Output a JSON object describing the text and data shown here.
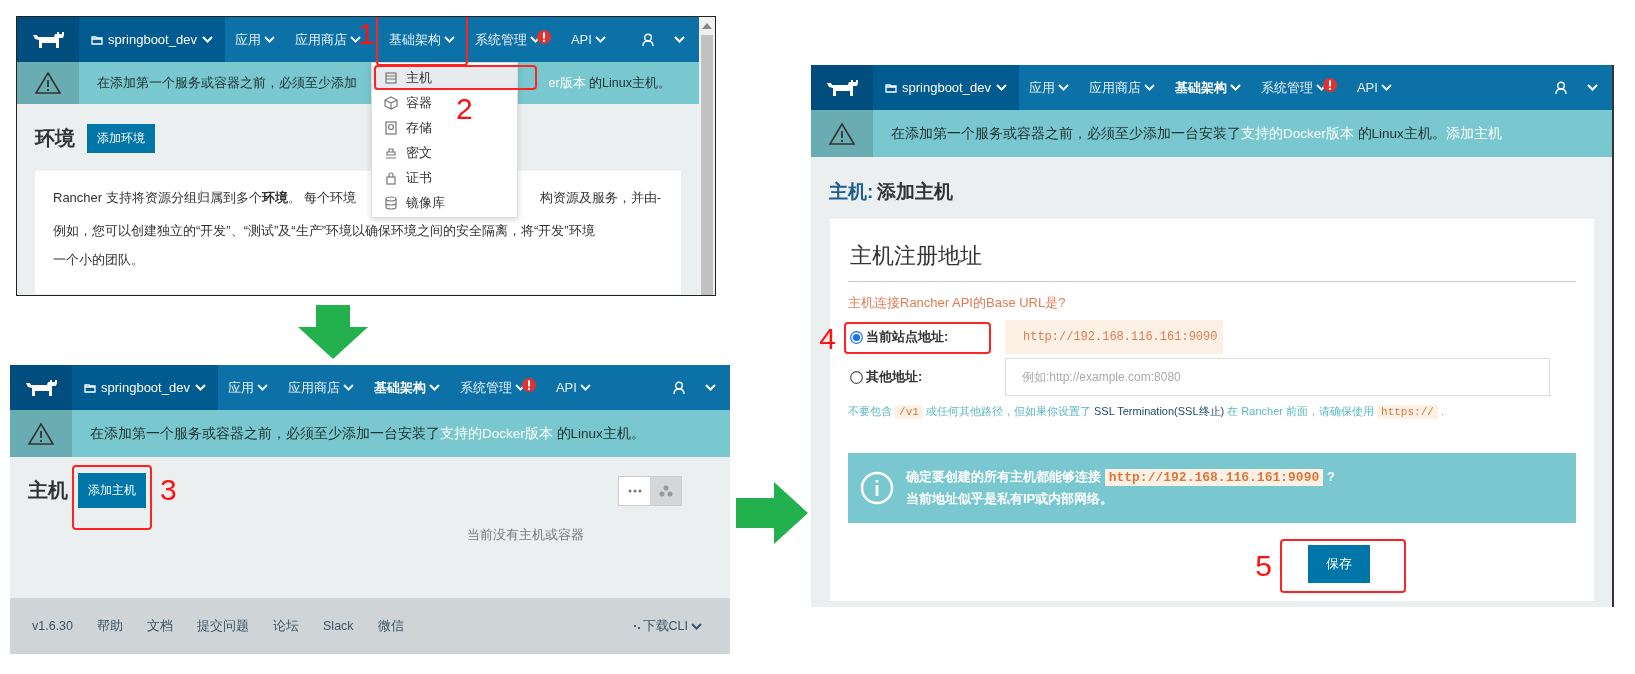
{
  "environments_screen": {
    "nav": {
      "environment": "springboot_dev",
      "items": [
        {
          "label": "应用",
          "selected": false,
          "alert": false
        },
        {
          "label": "应用商店",
          "selected": false,
          "alert": false
        },
        {
          "label": "基础架构",
          "selected": false,
          "alert": false,
          "annotation": "1",
          "menu": [
            {
              "label": "主机",
              "selected": true,
              "annotation": "2"
            },
            {
              "label": "容器",
              "selected": false
            },
            {
              "label": "存储",
              "selected": false
            },
            {
              "label": "密文",
              "selected": false
            },
            {
              "label": "证书",
              "selected": false
            },
            {
              "label": "镜像库",
              "selected": false
            }
          ]
        },
        {
          "label": "系统管理",
          "selected": false,
          "alert": true
        },
        {
          "label": "API",
          "selected": false,
          "alert": false
        }
      ]
    },
    "banner": {
      "text": "在添加第一个服务或容器之前，必须至少添加",
      "link_tail": "er版本",
      "text_tail": " 的Linux主机。"
    },
    "title": "环境",
    "add_button": "添加环境",
    "description_lines": [
      [
        "Rancher 支持将资源分组归属到多个**环境**。 每个环境",
        "构资源及服务，并由-"
      ],
      [
        "例如，您可以创建独立的“开发”、“测试”及“生产”环境以确保环境之间的安全隔离，将“开发”环境"
      ],
      [
        "一个小的团队。"
      ]
    ]
  },
  "hosts_screen": {
    "nav": {
      "environment": "springboot_dev",
      "items": [
        {
          "label": "应用",
          "selected": false,
          "alert": false
        },
        {
          "label": "应用商店",
          "selected": false,
          "alert": false
        },
        {
          "label": "基础架构",
          "selected": true,
          "alert": false
        },
        {
          "label": "系统管理",
          "selected": false,
          "alert": true
        },
        {
          "label": "API",
          "selected": false,
          "alert": false
        }
      ]
    },
    "banner": {
      "text": "在添加第一个服务或容器之前，必须至少添加一台安装了",
      "link": "支持的Docker版本",
      "text_after": " 的Linux主机。"
    },
    "title": "主机",
    "add_button": {
      "label": "添加主机",
      "annotation": "3"
    },
    "view_toggle": [
      {
        "selected": false
      },
      {
        "selected": true
      }
    ],
    "empty_message": "当前没有主机或容器",
    "footer": {
      "version": "v1.6.30",
      "links": [
        "帮助",
        "文档",
        "提交问题",
        "论坛",
        "Slack",
        "微信"
      ],
      "download": "下载CLI"
    }
  },
  "add_host_screen": {
    "nav": {
      "environment": "springboot_dev",
      "items": [
        {
          "label": "应用",
          "selected": false,
          "alert": false
        },
        {
          "label": "应用商店",
          "selected": false,
          "alert": false
        },
        {
          "label": "基础架构",
          "selected": true,
          "alert": false
        },
        {
          "label": "系统管理",
          "selected": false,
          "alert": true
        },
        {
          "label": "API",
          "selected": false,
          "alert": false
        }
      ]
    },
    "banner": {
      "text": "在添加第一个服务或容器之前，必须至少添加一台安装了",
      "link": "支持的Docker版本",
      "text_after": " 的Linux主机。",
      "action": "添加主机"
    },
    "title_prefix": "主机:",
    "title": "添加主机",
    "section_title": "主机注册地址",
    "question": "主机连接Rancher API的Base URL是?",
    "options": [
      {
        "kind": "value",
        "label": "当前站点地址:",
        "selected": true,
        "value": "http://192.168.116.161:9090",
        "annotation": "4"
      },
      {
        "kind": "input",
        "label": "其他地址:",
        "selected": false,
        "placeholder": "例如:http://example.com:8080"
      }
    ],
    "help": [
      {
        "kind": "text",
        "text": "不要包含 "
      },
      {
        "kind": "code",
        "text": "/v1"
      },
      {
        "kind": "text",
        "text": " 或任何其他路径，但如果你设置了 "
      },
      {
        "kind": "strong",
        "text": "SSL Termination(SSL终止)"
      },
      {
        "kind": "text",
        "text": " 在 Rancher 前面，请确保使用 "
      },
      {
        "kind": "code",
        "text": "https://"
      },
      {
        "kind": "text",
        "text": " ."
      }
    ],
    "info_lines": [
      [
        {
          "kind": "text",
          "text": "确定要创建的所有主机都能够连接 "
        },
        {
          "kind": "code",
          "text": "http://192.168.116.161:9090"
        },
        {
          "kind": "text",
          "text": " ?"
        }
      ],
      [
        {
          "kind": "text",
          "text": "当前地址似乎是私有IP或内部网络。"
        }
      ]
    ],
    "save_button": {
      "label": "保存",
      "annotation": "5"
    }
  }
}
